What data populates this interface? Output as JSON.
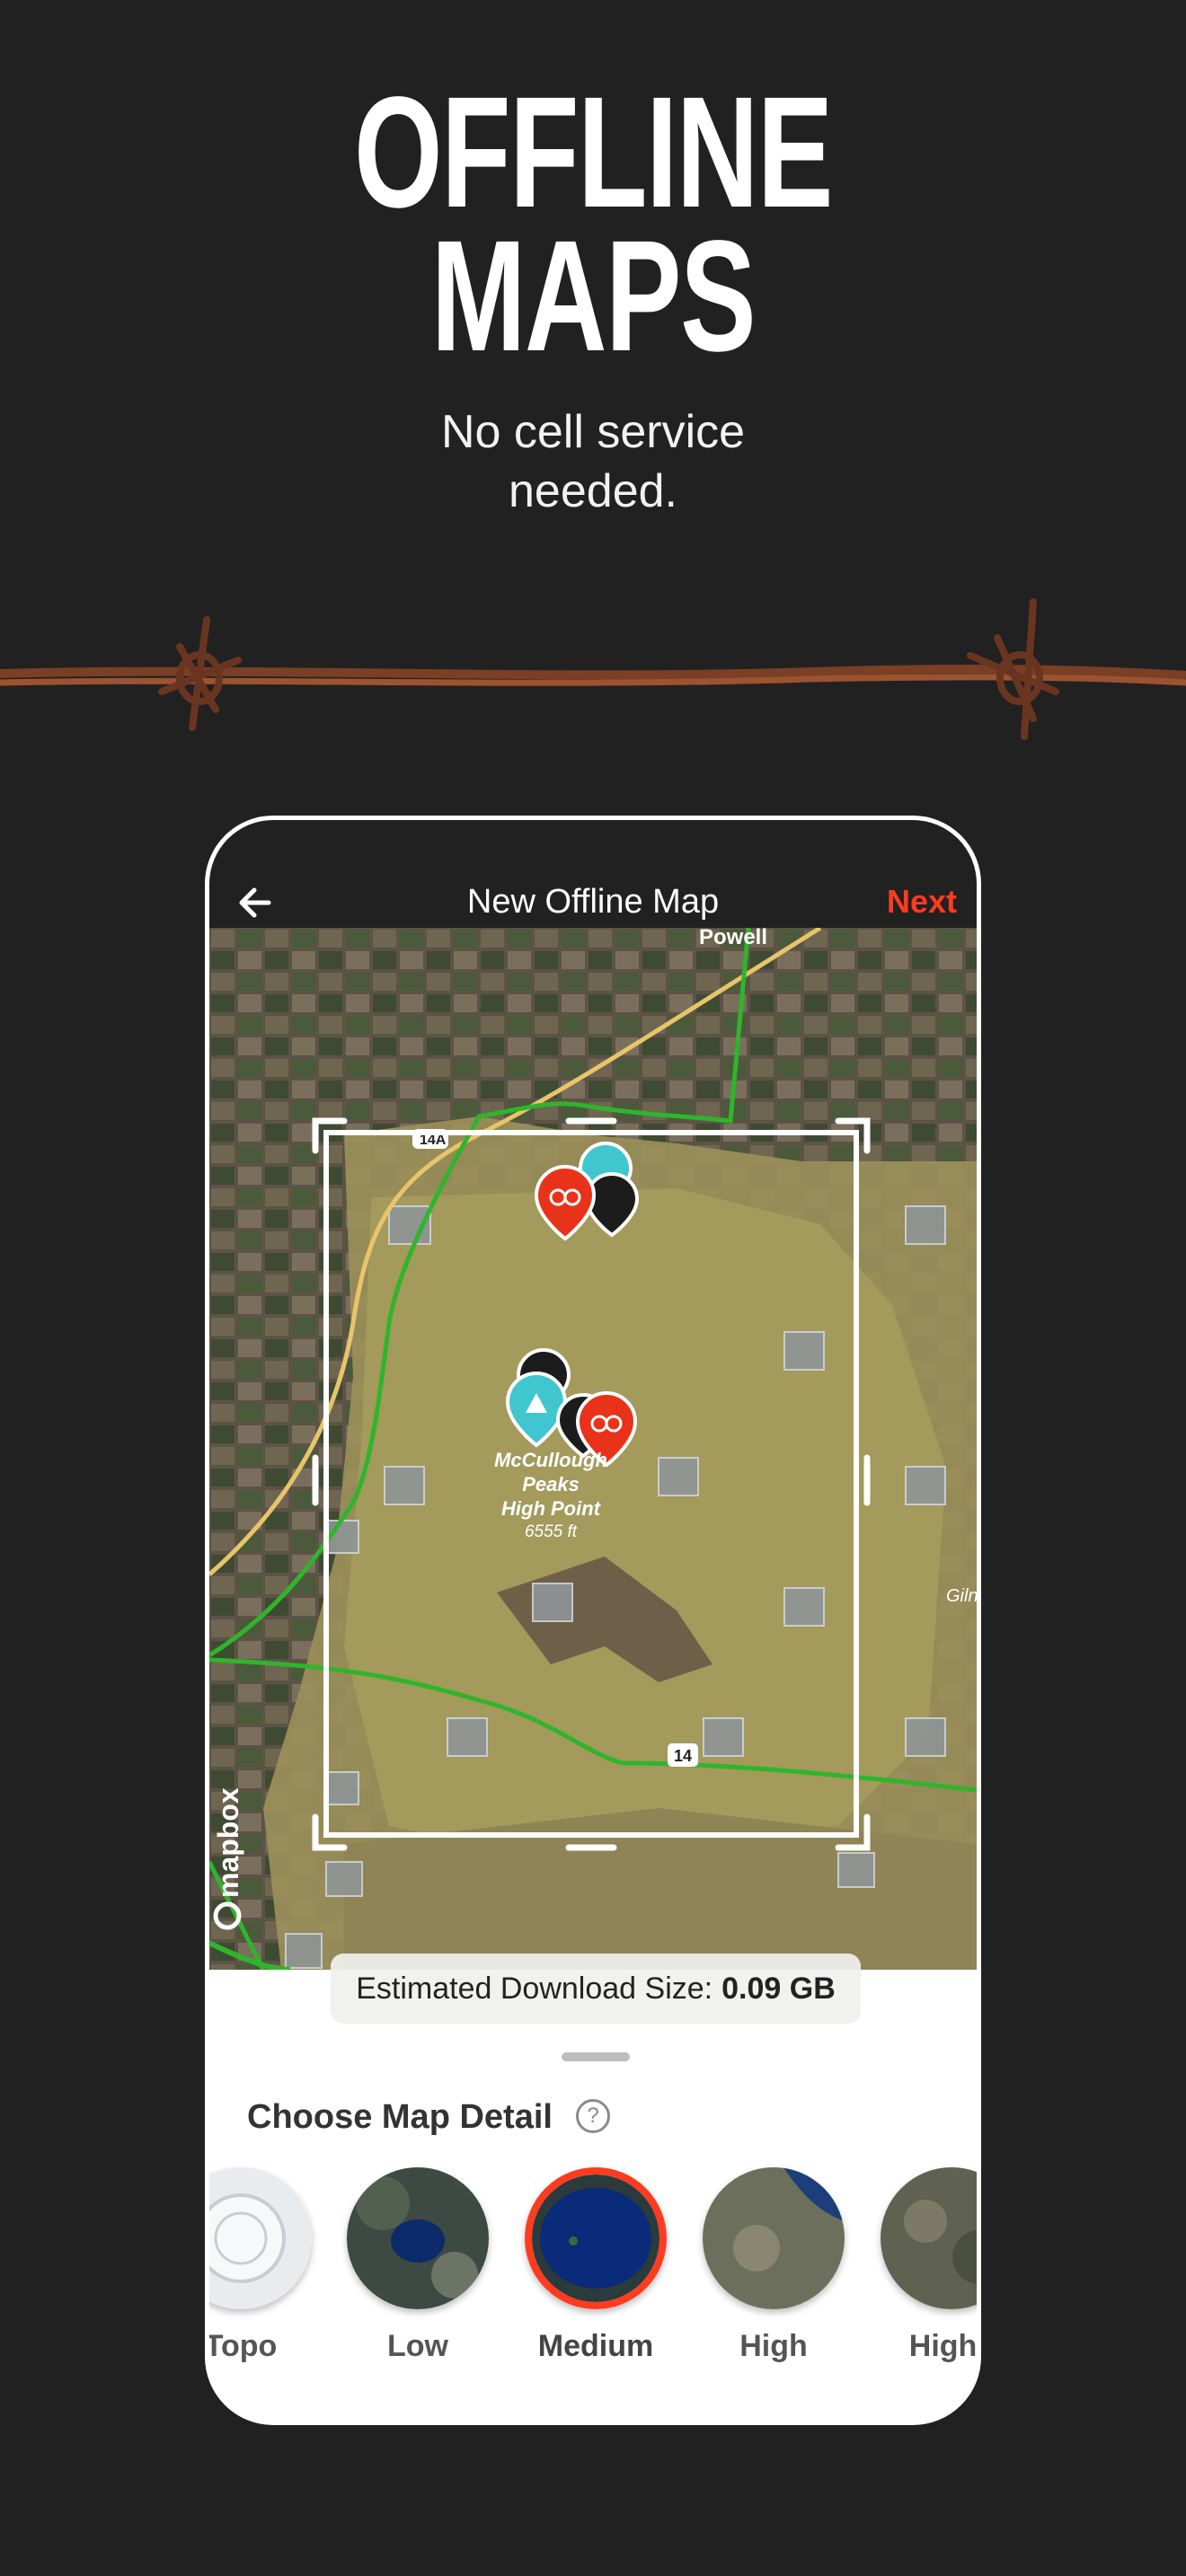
{
  "promo": {
    "headline_line1": "OFFLINE",
    "headline_line2": "MAPS",
    "subhead_line1": "No cell service",
    "subhead_line2": "needed."
  },
  "app": {
    "title": "New Offline Map",
    "next_label": "Next",
    "back_icon": "arrow-left-icon"
  },
  "map": {
    "place_label": "Powell",
    "peak_label_line1": "McCullough",
    "peak_label_line2": "Peaks",
    "peak_label_line3": "High Point",
    "peak_elevation": "6555 ft",
    "edge_label": "Giln",
    "highway_14": "14",
    "highway_14a": "14A",
    "attribution": "mapbox"
  },
  "download": {
    "label": "Estimated Download Size:",
    "value": "0.09 GB"
  },
  "detail": {
    "title": "Choose Map Detail",
    "help_icon": "question-icon",
    "options": [
      {
        "label": "Topo"
      },
      {
        "label": "Low"
      },
      {
        "label": "Medium"
      },
      {
        "label": "High"
      },
      {
        "label": "Highe"
      }
    ],
    "selected": "Medium"
  },
  "colors": {
    "accent": "#ff3b1f",
    "background": "#222121",
    "road_green": "#2fb52c",
    "road_yellow": "#e8c46a"
  }
}
